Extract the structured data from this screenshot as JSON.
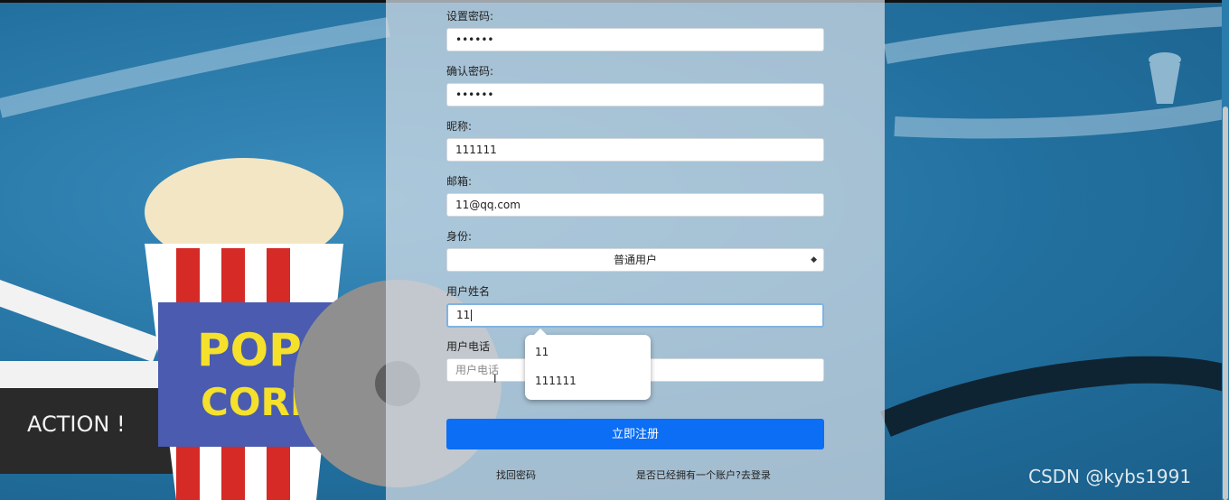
{
  "form": {
    "password_label": "设置密码:",
    "password_value": "••••••",
    "confirm_label": "确认密码:",
    "confirm_value": "••••••",
    "nickname_label": "昵称:",
    "nickname_value": "111111",
    "email_label": "邮箱:",
    "email_value": "11@qq.com",
    "role_label": "身份:",
    "role_value": "普通用户",
    "realname_label": "用户姓名",
    "realname_value": "11",
    "phone_label": "用户电话",
    "phone_placeholder": "用户电话",
    "submit_label": "立即注册",
    "forgot_link": "找回密码",
    "login_link": "是否已经拥有一个账户?去登录"
  },
  "autocomplete": {
    "items": [
      "11",
      "111111"
    ]
  },
  "background": {
    "poster_text_1": "POP",
    "poster_text_2": "CORN",
    "clapper_text": "ACTION !"
  },
  "watermark": "CSDN @kybs1991",
  "colors": {
    "primary_button": "#0b6ef5",
    "background_blue": "#2378a8"
  }
}
